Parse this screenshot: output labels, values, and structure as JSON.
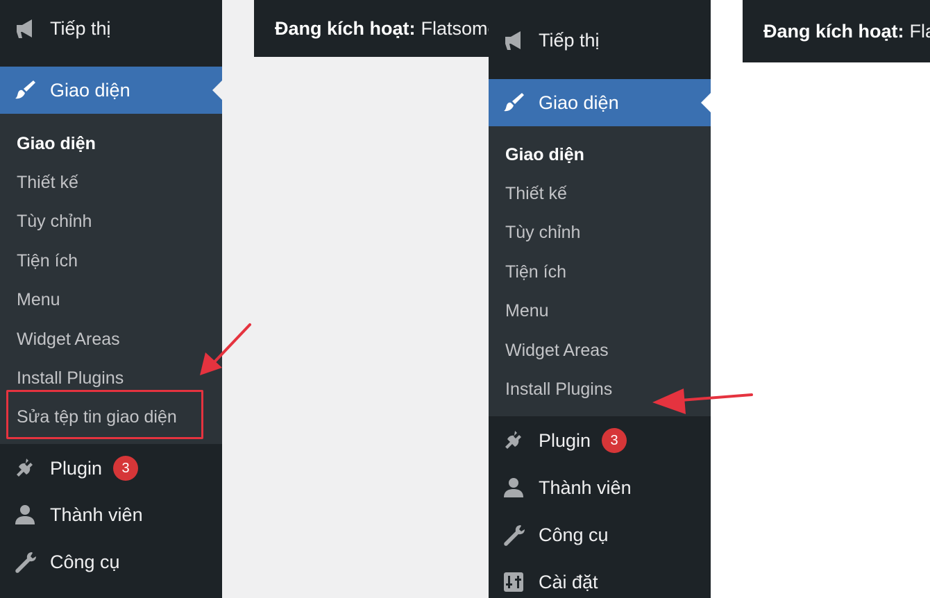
{
  "left_panel": {
    "top_menu": [
      {
        "label": "Tiếp thị",
        "icon": "megaphone-icon"
      },
      {
        "label": "Giao diện",
        "icon": "paintbrush-icon",
        "active": true
      }
    ],
    "submenu": [
      {
        "label": "Giao diện",
        "current": true
      },
      {
        "label": "Thiết kế"
      },
      {
        "label": "Tùy chỉnh"
      },
      {
        "label": "Tiện ích"
      },
      {
        "label": "Menu"
      },
      {
        "label": "Widget Areas"
      },
      {
        "label": "Install Plugins"
      },
      {
        "label": "Sửa tệp tin giao diện",
        "highlighted": true
      }
    ],
    "bottom_menu": [
      {
        "label": "Plugin",
        "icon": "plug-icon",
        "badge": "3"
      },
      {
        "label": "Thành viên",
        "icon": "user-icon"
      },
      {
        "label": "Công cụ",
        "icon": "wrench-icon"
      }
    ],
    "topbar": {
      "label": "Đang kích hoạt:",
      "value": "Flatsome"
    }
  },
  "right_panel": {
    "top_menu": [
      {
        "label": "Tiếp thị",
        "icon": "megaphone-icon"
      },
      {
        "label": "Giao diện",
        "icon": "paintbrush-icon",
        "active": true
      }
    ],
    "submenu": [
      {
        "label": "Giao diện",
        "current": true
      },
      {
        "label": "Thiết kế"
      },
      {
        "label": "Tùy chỉnh"
      },
      {
        "label": "Tiện ích"
      },
      {
        "label": "Menu"
      },
      {
        "label": "Widget Areas"
      },
      {
        "label": "Install Plugins"
      }
    ],
    "bottom_menu": [
      {
        "label": "Plugin",
        "icon": "plug-icon",
        "badge": "3"
      },
      {
        "label": "Thành viên",
        "icon": "user-icon"
      },
      {
        "label": "Công cụ",
        "icon": "wrench-icon"
      },
      {
        "label": "Cài đặt",
        "icon": "sliders-icon"
      }
    ],
    "topbar": {
      "label": "Đang kích hoạt:",
      "value": "Flatsome"
    }
  },
  "colors": {
    "sidebar_bg": "#1d2327",
    "submenu_bg": "#2c3338",
    "active_bg": "#3a70b1",
    "badge_bg": "#d63638",
    "annotation_red": "#e5333f"
  }
}
